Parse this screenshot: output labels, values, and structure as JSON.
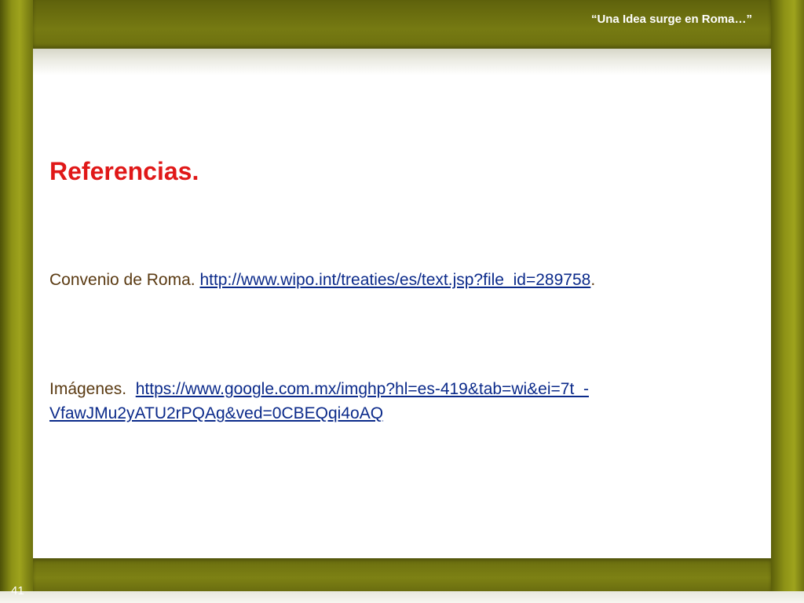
{
  "header": {
    "title": "“Una Idea surge en Roma…”"
  },
  "slide": {
    "heading": "Referencias.",
    "references": [
      {
        "label": "Convenio de Roma.",
        "link": "http://www.wipo.int/treaties/es/text.jsp?file_id=289758",
        "suffix": "."
      },
      {
        "label": "Imágenes.",
        "link_line1": "https://www.google.com.mx/imghp?hl=es-419&tab=wi&ei=7t_-",
        "link_line2": "VfawJMu2yATU2rPQAg&ved=0CBEQqi4oAQ"
      }
    ]
  },
  "footer": {
    "page_number": "41"
  },
  "colors": {
    "frame": "#8d9216",
    "heading": "#e01818",
    "body_text": "#5a3a12",
    "link": "#0b2a8a"
  }
}
